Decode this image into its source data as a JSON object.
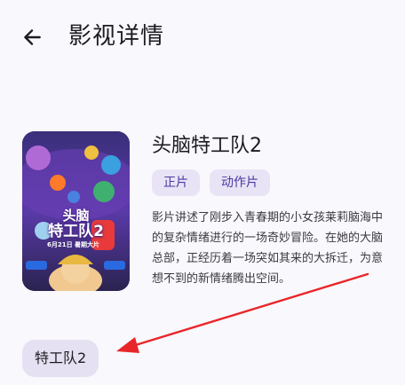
{
  "header": {
    "back_icon": "arrow-left-icon",
    "title": "影视详情"
  },
  "movie": {
    "poster": {
      "title_line1": "头脑",
      "title_line2": "特工队2",
      "date": "6月21日 暑期大片",
      "colors": [
        "#2a2350",
        "#6b3fb8",
        "#e83a3a",
        "#3aa0e0",
        "#f0c040",
        "#ff7a2a"
      ]
    },
    "title": "头脑特工队2",
    "tags": [
      "正片",
      "动作片"
    ],
    "synopsis": "影片讲述了刚步入青春期的小女孩莱莉脑海中的复杂情绪进行的一场奇妙冒险。在她的大脑总部，正经历着一场突如其来的大拆迁，为意想不到的新情绪腾出空间。"
  },
  "suggestion_chip": {
    "label": "特工队2"
  },
  "annotation": {
    "arrow_color": "#e8262a"
  }
}
